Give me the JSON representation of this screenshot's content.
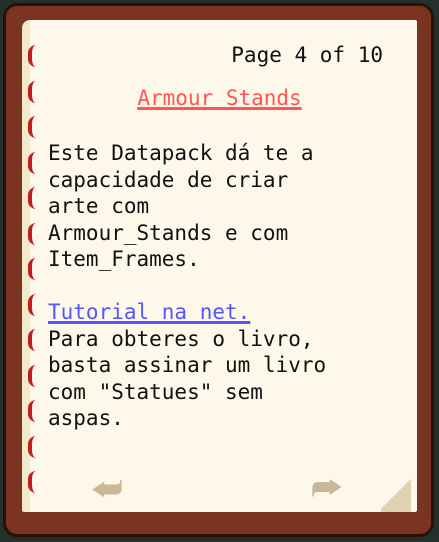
{
  "header": {
    "page_indicator": "Page 4 of 10"
  },
  "content": {
    "title": "Armour Stands",
    "paragraph": [
      "Este Datapack dá te a",
      "capacidade de criar",
      "arte com",
      "Armour_Stands e com",
      "Item_Frames."
    ],
    "link": "Tutorial na net.",
    "paragraph2": [
      "Para obteres o livro,",
      "basta assinar um livro",
      "com \"Statues\" sem",
      "aspas."
    ]
  },
  "nav": {
    "previous_icon": "arrow-left-icon",
    "next_icon": "arrow-right-icon"
  },
  "colors": {
    "title": "#FF5555",
    "link": "#5555FF",
    "text": "#111111",
    "cover": "#7A3422",
    "page": "#FDF8EA"
  }
}
